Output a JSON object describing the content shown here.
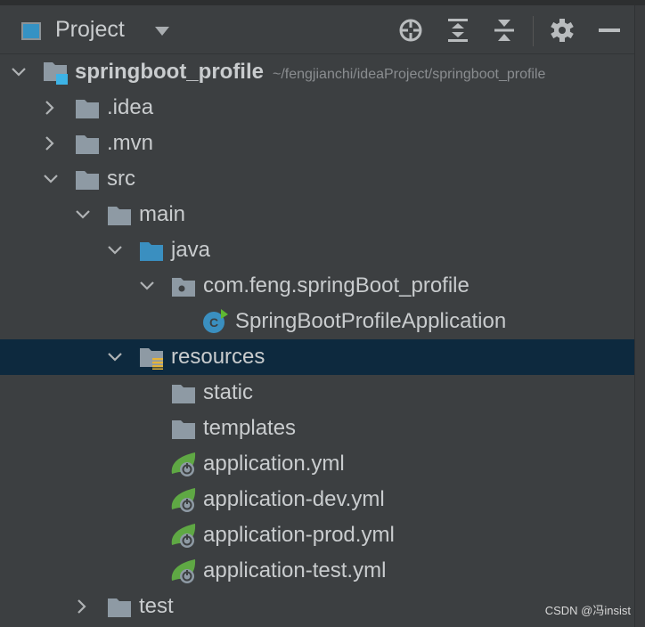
{
  "header": {
    "title": "Project",
    "icons": [
      "crosshair-icon",
      "expand-all-icon",
      "collapse-all-icon",
      "gear-icon",
      "minimize-icon"
    ]
  },
  "tree": [
    {
      "label": "springboot_profile",
      "path": "~/fengjianchi/ideaProject/springboot_profile",
      "level": 0,
      "expanded": true,
      "icon": "module",
      "bold": true
    },
    {
      "label": ".idea",
      "level": 1,
      "expanded": false,
      "icon": "folder"
    },
    {
      "label": ".mvn",
      "level": 1,
      "expanded": false,
      "icon": "folder"
    },
    {
      "label": "src",
      "level": 1,
      "expanded": true,
      "icon": "folder"
    },
    {
      "label": "main",
      "level": 2,
      "expanded": true,
      "icon": "folder"
    },
    {
      "label": "java",
      "level": 3,
      "expanded": true,
      "icon": "source-folder"
    },
    {
      "label": "com.feng.springBoot_profile",
      "level": 4,
      "expanded": true,
      "icon": "package"
    },
    {
      "label": "SpringBootProfileApplication",
      "level": 5,
      "icon": "spring-class"
    },
    {
      "label": "resources",
      "level": 3,
      "expanded": true,
      "icon": "resources-folder",
      "selected": true
    },
    {
      "label": "static",
      "level": 4,
      "icon": "folder"
    },
    {
      "label": "templates",
      "level": 4,
      "icon": "folder"
    },
    {
      "label": "application.yml",
      "level": 4,
      "icon": "spring-yml"
    },
    {
      "label": "application-dev.yml",
      "level": 4,
      "icon": "spring-yml"
    },
    {
      "label": "application-prod.yml",
      "level": 4,
      "icon": "spring-yml"
    },
    {
      "label": "application-test.yml",
      "level": 4,
      "icon": "spring-yml"
    },
    {
      "label": "test",
      "level": 2,
      "expanded": false,
      "icon": "folder"
    }
  ],
  "watermark": "CSDN @冯insist",
  "colors": {
    "background": "#3c3f41",
    "selection": "#0d293e",
    "folder": "#8e9aa4",
    "accent": "#3592c4",
    "spring": "#5fa844"
  }
}
